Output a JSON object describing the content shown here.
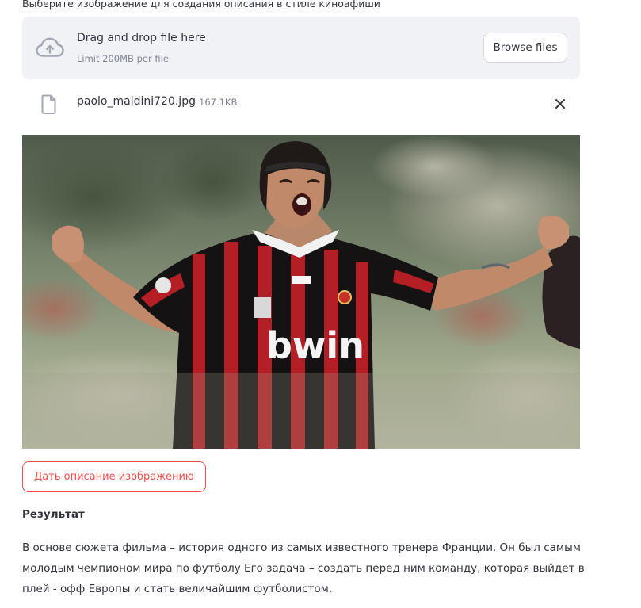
{
  "uploader": {
    "label": "Выберите изображение для создания описания в стиле киноафиши",
    "dropzone_title": "Drag and drop file here",
    "dropzone_limit": "Limit 200MB per file",
    "browse_label": "Browse files"
  },
  "file": {
    "name": "paolo_maldini720.jpg",
    "size": "167.1KB"
  },
  "image": {
    "jersey_sponsor": "bwin"
  },
  "action": {
    "describe_label": "Дать описание изображению"
  },
  "result": {
    "heading": "Результат",
    "text": "В основе сюжета фильма – история одного из самых известного тренера Франции. Он был самым молодым чемпионом мира по футболу Его задача – создать перед ним команду, которая выйдет в плей - офф Европы и стать величайшим футболистом."
  },
  "colors": {
    "accent": "#ff4b4b",
    "dropzone_bg": "#f0f2f6",
    "text": "#31333f",
    "muted": "#808495"
  },
  "icons": {
    "upload": "cloud-upload-icon",
    "file": "file-icon",
    "close": "close-icon"
  }
}
